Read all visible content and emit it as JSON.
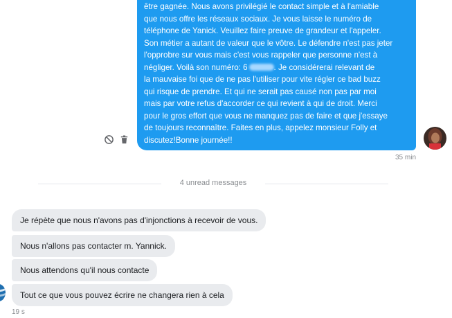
{
  "sent_message": {
    "lines": [
      "être gagnée. Nous avons privilégié le contact simple et à l'amiable",
      "que nous offre les réseaux sociaux. Je vous laisse le numéro de",
      "téléphone de Yanick. Veuillez faire preuve de grandeur et l'appeler.",
      "Son métier a autant de valeur que le vôtre. Le défendre n'est pas jeter",
      "l'opprobre sur vous mais c'est vous rappeler que personne n'est à",
      "négliger. Voilà son numéro: 6",
      ". Je considérerai relevant de",
      "la mauvaise foi que de ne pas l'utiliser pour vite régler ce bad buzz",
      "qui risque de prendre. Et qui ne serait pas causé non pas par moi",
      "mais par votre refus d'accorder ce qui revient à qui de droit. Merci",
      "pour le gros effort que vous ne manquez pas de faire et que j'essaye",
      "de toujours reconnaître. Faites en plus, appelez monsieur Folly et",
      "discutez!Bonne journée!!"
    ],
    "time": "35 min"
  },
  "divider_label": "4 unread messages",
  "received_messages": [
    "Je répète que nous n'avons pas d'injonctions à recevoir de vous.",
    "Nous n'allons pas contacter m. Yannick.",
    "Nous attendons qu'il nous contacte",
    "Tout ce que vous pouvez écrire ne changera rien à cela"
  ],
  "received_time": "19 s",
  "colors": {
    "sent_bubble": "#1e9bf0",
    "received_bubble": "#e9ebee",
    "muted_text": "#8a8d91"
  },
  "icons": {
    "block": "block-icon",
    "delete": "trash-icon"
  }
}
